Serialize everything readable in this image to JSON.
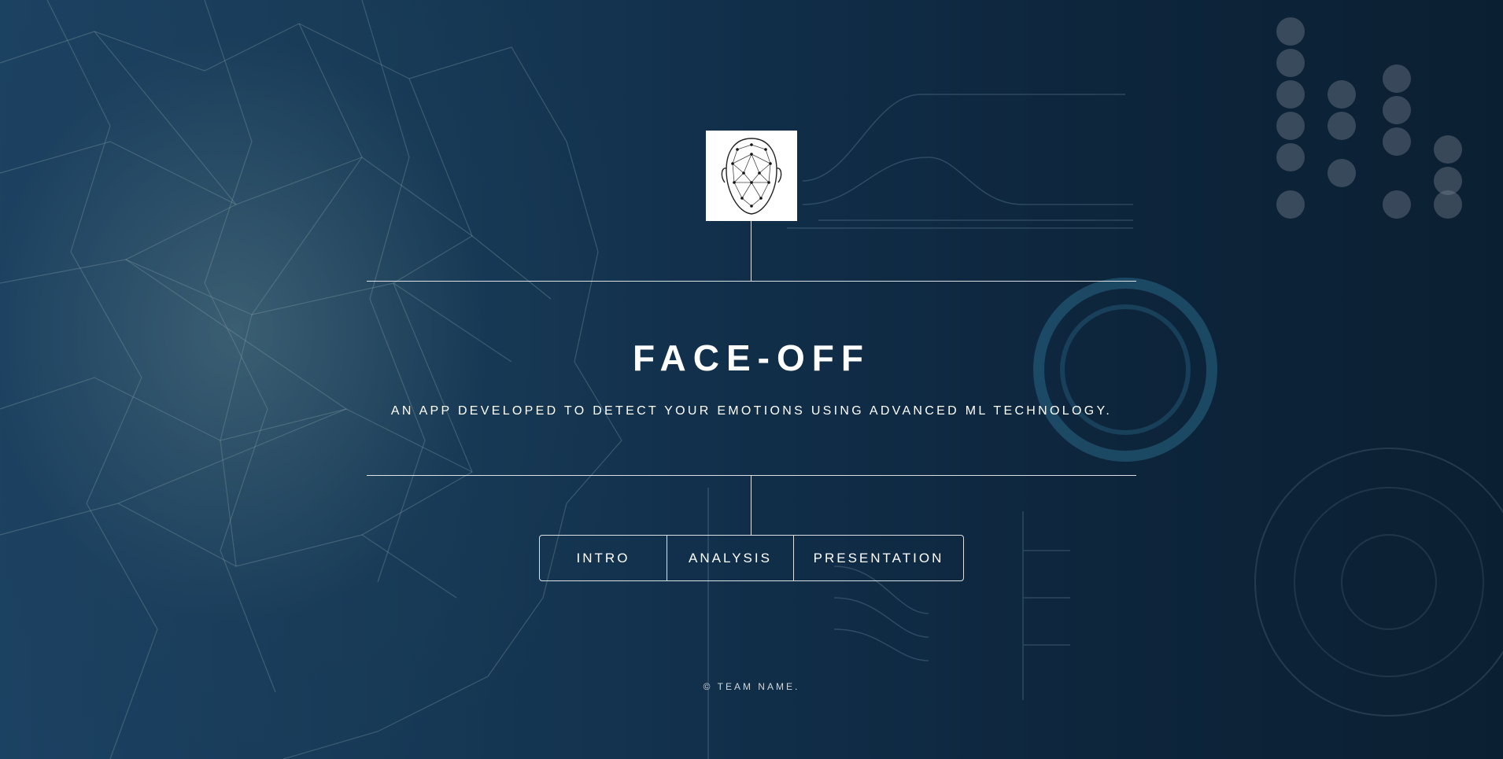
{
  "hero": {
    "logo_icon": "face-mesh-icon",
    "title": "FACE-OFF",
    "subtitle": "AN APP DEVELOPED TO DETECT YOUR EMOTIONS USING ADVANCED ML TECHNOLOGY."
  },
  "nav": {
    "items": [
      {
        "label": "INTRO"
      },
      {
        "label": "ANALYSIS"
      },
      {
        "label": "PRESENTATION"
      }
    ]
  },
  "footer": {
    "text": "© TEAM NAME."
  },
  "colors": {
    "background_dark": "#0c2236",
    "background_blue": "#24527a",
    "text": "#ffffff"
  }
}
